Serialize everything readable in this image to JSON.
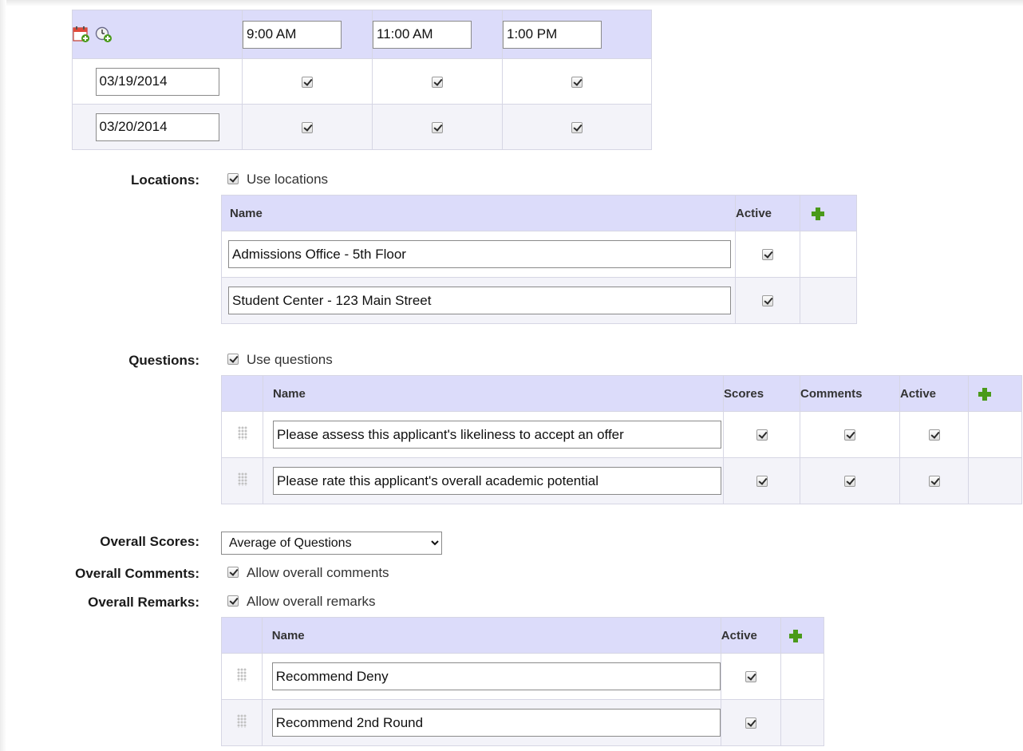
{
  "schedule": {
    "times": [
      "9:00 AM",
      "11:00 AM",
      "1:00 PM"
    ],
    "dates": [
      "03/19/2014",
      "03/20/2014"
    ]
  },
  "locations": {
    "label": "Locations:",
    "use_label": "Use locations",
    "col_name": "Name",
    "col_active": "Active",
    "rows": [
      "Admissions Office - 5th Floor",
      "Student Center - 123 Main Street"
    ]
  },
  "questions": {
    "label": "Questions:",
    "use_label": "Use questions",
    "col_name": "Name",
    "col_scores": "Scores",
    "col_comments": "Comments",
    "col_active": "Active",
    "rows": [
      "Please assess this applicant's likeliness to accept an offer",
      "Please rate this applicant's overall academic potential"
    ]
  },
  "overall": {
    "scores_label": "Overall Scores:",
    "scores_value": "Average of Questions",
    "comments_label": "Overall Comments:",
    "comments_option": "Allow overall comments",
    "remarks_label": "Overall Remarks:",
    "remarks_option": "Allow overall remarks"
  },
  "remarks": {
    "col_name": "Name",
    "col_active": "Active",
    "rows": [
      "Recommend Deny",
      "Recommend 2nd Round"
    ]
  },
  "icons": {
    "add_date": "calendar-add-icon",
    "add_time": "clock-add-icon",
    "add_row": "plus-icon",
    "drag": "drag-handle-icon"
  },
  "colors": {
    "header_bg": "#dcdcfa",
    "alt_row_bg": "#f3f3f9",
    "add_green": "#4a9a1a"
  }
}
